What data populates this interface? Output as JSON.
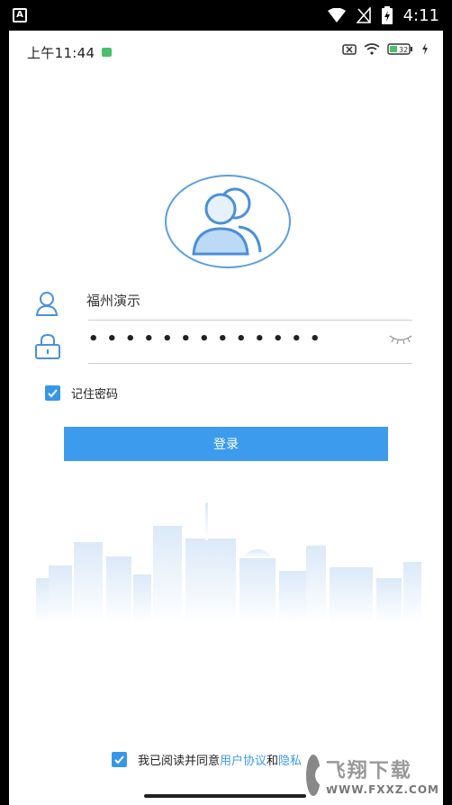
{
  "system_bar": {
    "app_icon_letter": "A",
    "time": "4:11"
  },
  "app_status": {
    "time": "上午11:44",
    "battery": "32"
  },
  "login": {
    "username_value": "福州演示",
    "password_mask": "•••••••••••••",
    "remember_label": "记住密码",
    "remember_checked": true,
    "button_label": "登录"
  },
  "agreement": {
    "text": "我已阅读并同意",
    "user_agreement": "用户协议",
    "conjunction": "和",
    "privacy_partial": "隐私"
  },
  "watermark": {
    "cn": "飞翔下载",
    "en": "WWW.FXXZ.COM"
  },
  "colors": {
    "accent": "#3c9bec",
    "avatar_stroke": "#5a9fe0"
  }
}
